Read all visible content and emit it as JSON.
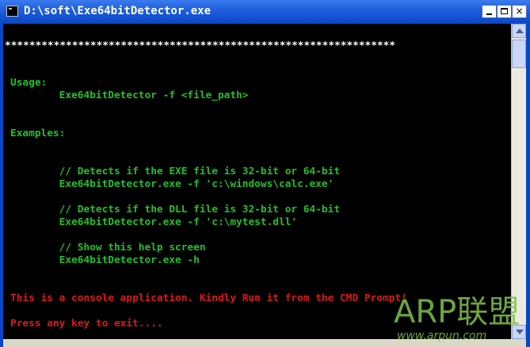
{
  "window": {
    "title": "D:\\soft\\Exe64bitDetector.exe",
    "close_glyph": "×"
  },
  "console": {
    "separator": "****************************************************************",
    "usage_label": "Usage:",
    "usage_command": "        Exe64bitDetector -f <file_path>",
    "examples_label": "Examples:",
    "ex1_comment": "        // Detects if the EXE file is 32-bit or 64-bit",
    "ex1_command": "        Exe64bitDetector.exe -f 'c:\\windows\\calc.exe'",
    "ex2_comment": "        // Detects if the DLL file is 32-bit or 64-bit",
    "ex2_command": "        Exe64bitDetector.exe -f 'c:\\mytest.dll'",
    "ex3_comment": "        // Show this help screen",
    "ex3_command": "        Exe64bitDetector.exe -h",
    "warning": "This is a console application. Kindly Run it from the CMD Prompt!",
    "press_key": "Press any key to exit...."
  },
  "watermark": {
    "logo": "ARP联盟",
    "url": "www.arpun.com"
  },
  "colors": {
    "console_bg": "#000000",
    "text_green": "#22c028",
    "text_red": "#e01818",
    "titlebar_blue": "#0a46c8"
  }
}
